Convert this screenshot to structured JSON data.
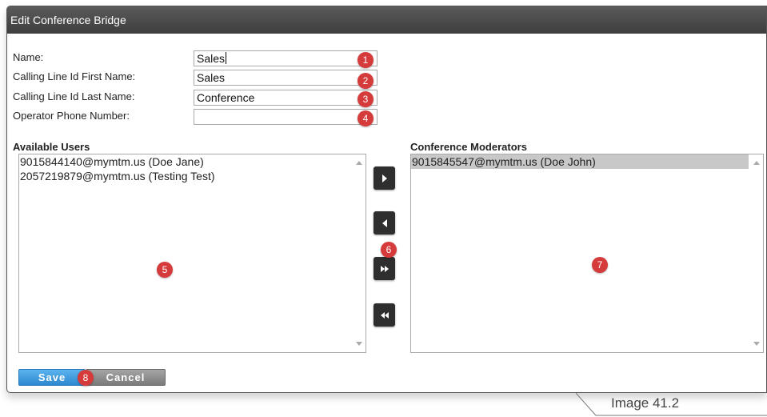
{
  "dialog": {
    "title": "Edit Conference Bridge"
  },
  "form": {
    "name_label": "Name:",
    "name_value": "Sales",
    "first_name_label": "Calling Line Id First Name:",
    "first_name_value": "Sales",
    "last_name_label": "Calling Line Id Last Name:",
    "last_name_value": "Conference",
    "operator_label": "Operator Phone Number:",
    "operator_value": ""
  },
  "available": {
    "title": "Available Users",
    "items": [
      "9015844140@mymtm.us (Doe Jane)",
      "2057219879@mymtm.us (Testing Test)"
    ]
  },
  "moderators": {
    "title": "Conference Moderators",
    "items": [
      "9015845547@mymtm.us (Doe John)"
    ]
  },
  "move_buttons": [
    "move-right",
    "move-left",
    "move-all-right",
    "move-all-left"
  ],
  "badges": [
    "1",
    "2",
    "3",
    "4",
    "5",
    "6",
    "7",
    "8"
  ],
  "buttons": {
    "save": "Save",
    "cancel": "Cancel"
  },
  "caption": "Image 41.2",
  "colors": {
    "badge": "#d63b3b",
    "titlebar": "#444444",
    "save": "#3a9be0",
    "cancel": "#8a8a8a"
  }
}
